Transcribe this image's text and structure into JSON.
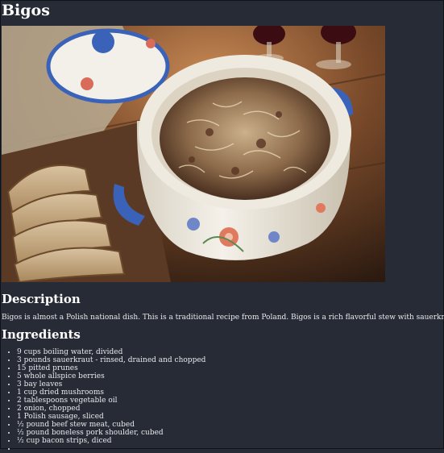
{
  "recipe": {
    "title": "Bigos",
    "image_alt": "Bigos in a painted ceramic pot with rye bread",
    "description_heading": "Description",
    "description": "Bigos is almost a Polish national dish. This is a traditional recipe from Poland. Bigos is a rich flavorful stew with sauerkraut, Polish sausage,",
    "ingredients_heading": "Ingredients",
    "ingredients": [
      "9 cups boiling water, divided",
      "3 pounds sauerkraut - rinsed, drained and chopped",
      "15 pitted prunes",
      "5 whole allspice berries",
      "3 bay leaves",
      "1 cup dried mushrooms",
      "2 tablespoons vegetable oil",
      "2 onion, chopped",
      "1 Polish sausage, sliced",
      "½ pound beef stew meat, cubed",
      "½ pound boneless pork shoulder, cubed",
      "½ cup bacon strips, diced",
      ""
    ]
  },
  "colors": {
    "page_background": "#262b35",
    "text": "#ffffff",
    "pot_blue": "#3a62b8",
    "wood": "#6b4128"
  }
}
